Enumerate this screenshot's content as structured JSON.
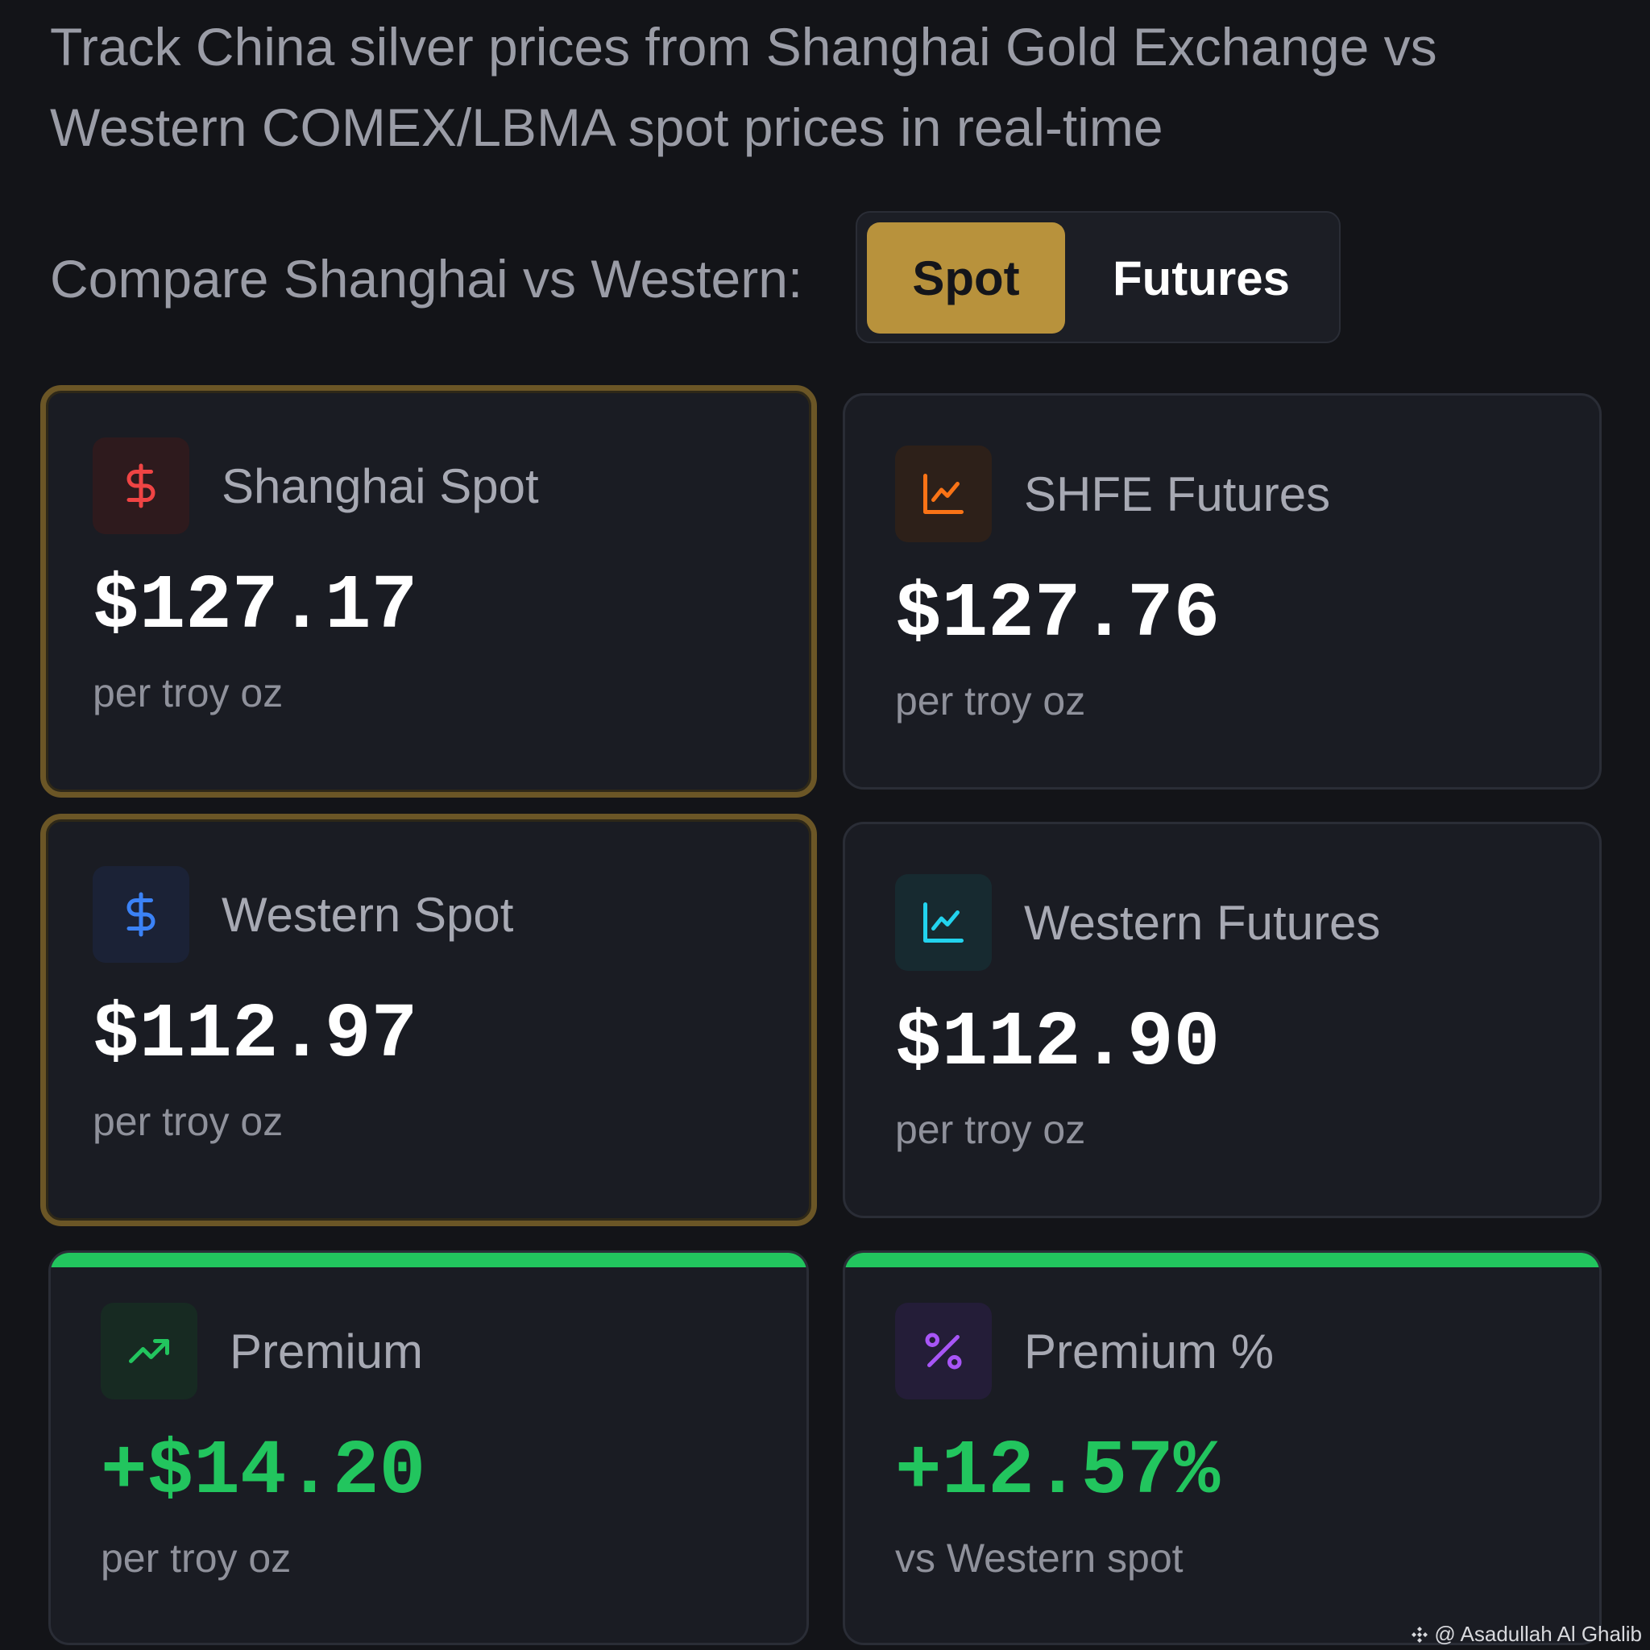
{
  "header": {
    "subtitle": "Track China silver prices from Shanghai Gold Exchange vs Western COMEX/LBMA spot prices in real-time"
  },
  "compare": {
    "label": "Compare Shanghai vs Western:",
    "options": [
      {
        "label": "Spot",
        "selected": true
      },
      {
        "label": "Futures",
        "selected": false
      }
    ]
  },
  "cards": [
    {
      "title": "Shanghai Spot",
      "value": "$127.17",
      "unit": "per troy oz",
      "icon": "dollar-icon",
      "accent": "#ef4444",
      "highlighted": true
    },
    {
      "title": "SHFE Futures",
      "value": "$127.76",
      "unit": "per troy oz",
      "icon": "line-chart-icon",
      "accent": "#f97316",
      "highlighted": false
    },
    {
      "title": "Western Spot",
      "value": "$112.97",
      "unit": "per troy oz",
      "icon": "dollar-icon",
      "accent": "#3b82f6",
      "highlighted": true
    },
    {
      "title": "Western Futures",
      "value": "$112.90",
      "unit": "per troy oz",
      "icon": "line-chart-icon",
      "accent": "#22d3ee",
      "highlighted": false
    },
    {
      "title": "Premium",
      "value": "+$14.20",
      "unit": "per troy oz",
      "icon": "trending-up-icon",
      "accent": "#22c55e",
      "highlighted": false
    },
    {
      "title": "Premium %",
      "value": "+12.57%",
      "unit": "vs Western spot",
      "icon": "percent-icon",
      "accent": "#a855f7",
      "highlighted": false
    }
  ],
  "colors": {
    "background": "#131418",
    "gold": "#b8923c",
    "positive": "#22c55e"
  },
  "watermark": {
    "text": "@ Asadullah Al Ghalib"
  }
}
